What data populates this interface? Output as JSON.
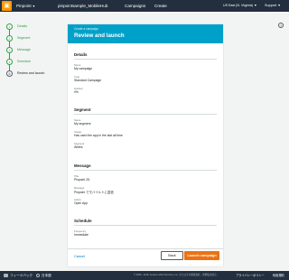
{
  "topbar": {
    "service": "Pinpoint",
    "project": "pinpointsample_MobileHub",
    "campaigns": "Campaigns",
    "create": "Create",
    "region": "US East (N. Virginia)",
    "support": "Support"
  },
  "steps": [
    {
      "num": "1",
      "label": "Details"
    },
    {
      "num": "2",
      "label": "Segment"
    },
    {
      "num": "3",
      "label": "Message"
    },
    {
      "num": "4",
      "label": "Schedule"
    },
    {
      "num": "5",
      "label": "Review and launch"
    }
  ],
  "panel": {
    "crumb": "Create a campaign",
    "title": "Review and launch",
    "details": {
      "title": "Details",
      "name_label": "Name",
      "name_value": "My campaign",
      "type_label": "Type",
      "type_value": "Standard Campaign",
      "holdout_label": "Holdout",
      "holdout_value": "0%"
    },
    "segment": {
      "title": "Segment",
      "name_label": "Name",
      "name_value": "My segment",
      "usage_label": "Usage",
      "usage_value": "Has used the app in the last all time",
      "segment_label": "Segment",
      "segment_value": "Writes"
    },
    "message": {
      "title": "Message",
      "title_label": "Title",
      "title_value": "Pinpoint 25.",
      "message_label": "Message",
      "message_value": "Pinpoint でモバイルトに送信",
      "action_label": "Action",
      "action_value": "Open App"
    },
    "schedule": {
      "title": "Schedule",
      "frequency_label": "Frequency",
      "frequency_value": "Immediate"
    },
    "cancel": "Cancel",
    "back": "Back",
    "launch": "Launch campaign"
  },
  "statusbar": {
    "feedback": "フィードバック",
    "language": "日本語",
    "copyright": "© 2008 - 2018, Amazon Web Services, Inc. またはその関連会社。無断転用禁止。",
    "privacy": "プライバシーポリシー",
    "terms": "利用規約"
  },
  "colors": {
    "topbar": "#232f3e",
    "header": "#00a1c9",
    "accent": "#ec7211",
    "step_done": "#2e9e44",
    "link": "#0073bb"
  }
}
